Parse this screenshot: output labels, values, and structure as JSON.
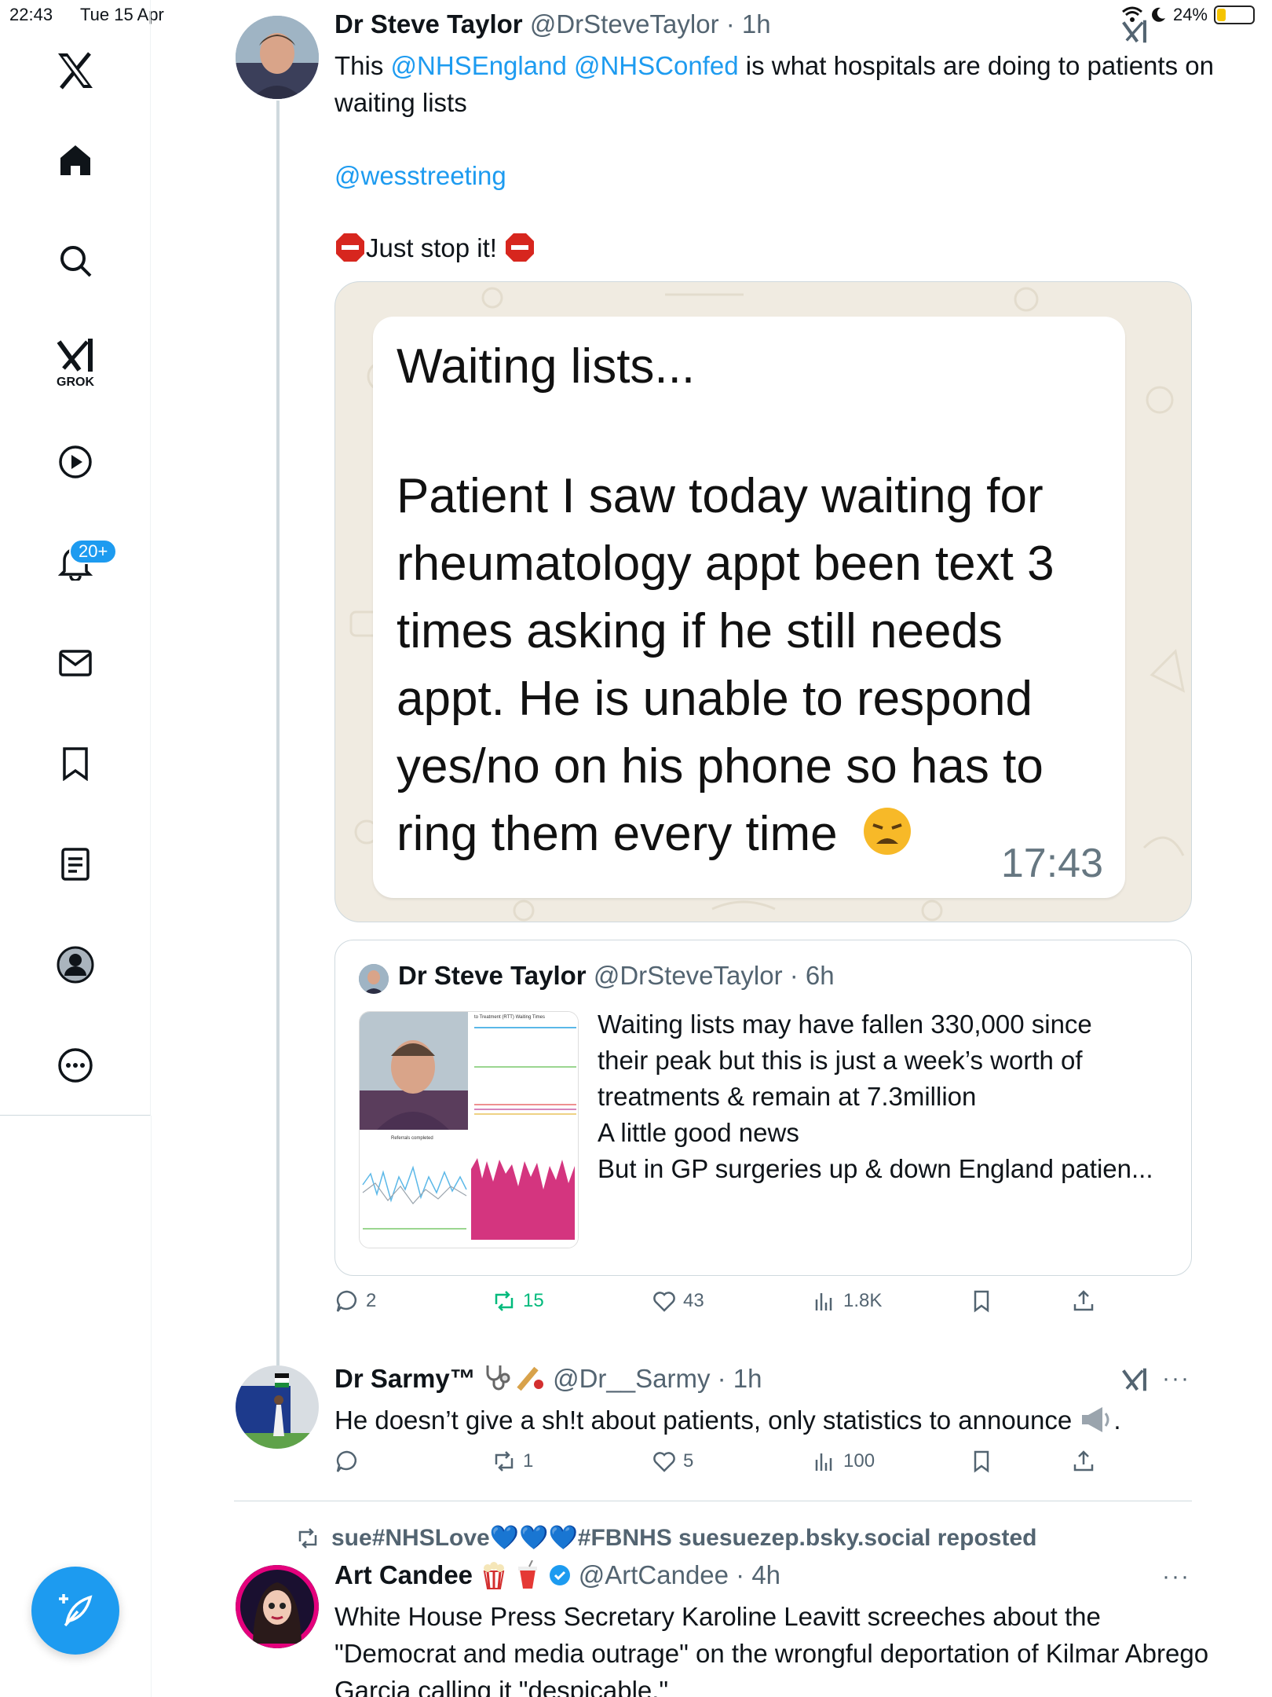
{
  "status_bar": {
    "time": "22:43",
    "date": "Tue 15 Apr",
    "battery": "24%",
    "battery_level": 0.24
  },
  "sidebar": {
    "items": [
      {
        "name": "x-logo",
        "label": ""
      },
      {
        "name": "home",
        "label": ""
      },
      {
        "name": "search",
        "label": ""
      },
      {
        "name": "grok",
        "label": "GROK"
      },
      {
        "name": "video",
        "label": ""
      },
      {
        "name": "notifications",
        "label": "",
        "badge": "20+"
      },
      {
        "name": "messages",
        "label": ""
      },
      {
        "name": "bookmarks",
        "label": ""
      },
      {
        "name": "lists",
        "label": ""
      },
      {
        "name": "profile",
        "label": ""
      },
      {
        "name": "more",
        "label": ""
      }
    ]
  },
  "tweet1": {
    "name": "Dr Steve Taylor",
    "handle": "@DrSteveTaylor",
    "time": "· 1h",
    "text_part1": "This ",
    "mention1": "@NHSEngland",
    "space": " ",
    "mention2": "@NHSConfed",
    "text_part2": " is what hospitals are doing to patients on waiting lists",
    "mention3": "@wesstreeting",
    "text_line3": "Just stop it! ",
    "image": {
      "title": "Waiting lists...",
      "body": "Patient I saw today waiting for rheumatology appt been text 3 times asking if he still needs appt. He is unable to respond yes/no on his phone so has to ring them every time",
      "time": "17:43"
    },
    "quote": {
      "name": "Dr Steve Taylor",
      "handle": "@DrSteveTaylor",
      "time": "· 6h",
      "line1": "Waiting lists may have fallen 330,000 since",
      "line2": "their peak but this is just a week’s worth of",
      "line3": "treatments & remain at 7.3million",
      "line4": "A little good news",
      "line5": "But in GP surgeries up & down England patien...",
      "thumb_title": "to Treatment (RTT) Waiting Times",
      "thumb_title2": "Referrals completed"
    },
    "actions": {
      "replies": "2",
      "reposts": "15",
      "likes": "43",
      "views": "1.8K"
    }
  },
  "tweet2": {
    "name": "Dr Sarmy™",
    "handle": "@Dr__Sarmy",
    "time": "· 1h",
    "text": "He doesn’t give a sh!t about patients, only statistics to announce",
    "text_end": ".",
    "actions": {
      "replies": "",
      "reposts": "1",
      "likes": "5",
      "views": "100"
    }
  },
  "tweet3": {
    "reposted_by": "sue#NHSLove💙💙💙#FBNHS suesuezep.bsky.social reposted",
    "name": "Art Candee",
    "handle": "@ArtCandee",
    "time": "· 4h",
    "text": "White House Press Secretary Karoline Leavitt screeches about the \"Democrat and media outrage\" on the wrongful deportation of Kilmar Abrego Garcia calling it \"despicable.\""
  },
  "colors": {
    "accent": "#1d9bf0",
    "repost_green": "#00ba7c",
    "muted": "#536471",
    "whatsapp_bg": "#f0ebe1"
  }
}
